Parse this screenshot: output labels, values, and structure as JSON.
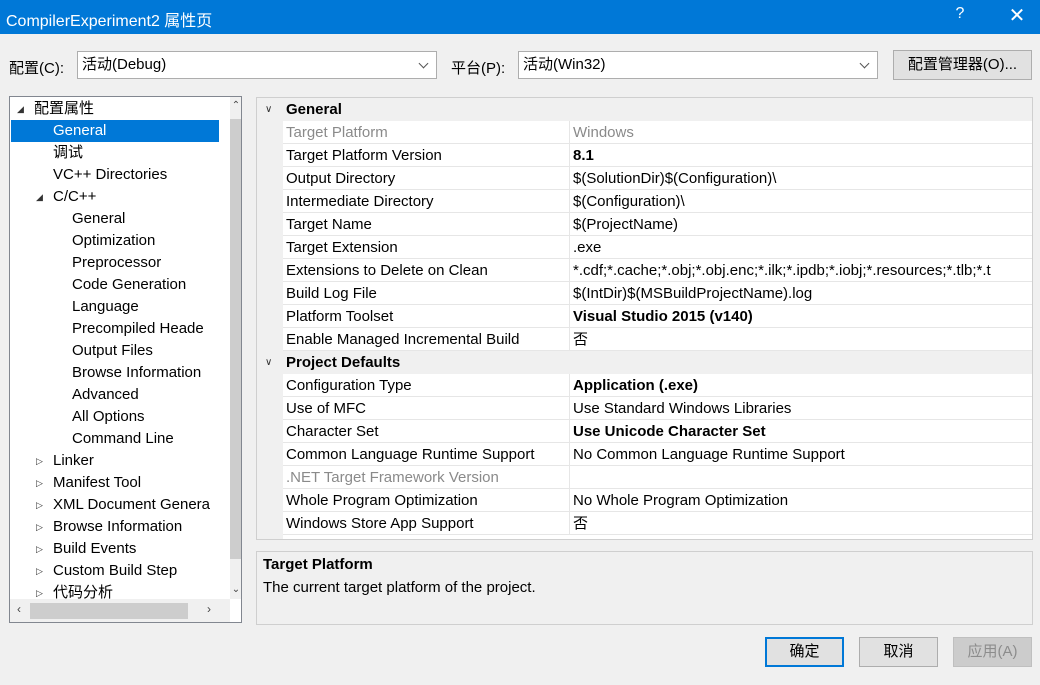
{
  "window": {
    "title": "CompilerExperiment2 属性页",
    "help_glyph": "?",
    "close_glyph": "✕"
  },
  "toolbar": {
    "config_label": "配置(C):",
    "config_value": "活动(Debug)",
    "platform_label": "平台(P):",
    "platform_value": "活动(Win32)",
    "config_manager_label": "配置管理器(O)..."
  },
  "tree": {
    "items": [
      {
        "label": "配置属性",
        "expander": "◢"
      },
      {
        "label": "General"
      },
      {
        "label": "调试"
      },
      {
        "label": "VC++ Directories"
      },
      {
        "label": "C/C++",
        "expander": "◢"
      },
      {
        "label": "General"
      },
      {
        "label": "Optimization"
      },
      {
        "label": "Preprocessor"
      },
      {
        "label": "Code Generation"
      },
      {
        "label": "Language"
      },
      {
        "label": "Precompiled Heade"
      },
      {
        "label": "Output Files"
      },
      {
        "label": "Browse Information"
      },
      {
        "label": "Advanced"
      },
      {
        "label": "All Options"
      },
      {
        "label": "Command Line"
      },
      {
        "label": "Linker",
        "expander": "▷"
      },
      {
        "label": "Manifest Tool",
        "expander": "▷"
      },
      {
        "label": "XML Document Genera",
        "expander": "▷"
      },
      {
        "label": "Browse Information",
        "expander": "▷"
      },
      {
        "label": "Build Events",
        "expander": "▷"
      },
      {
        "label": "Custom Build Step",
        "expander": "▷"
      },
      {
        "label": "代码分析",
        "expander": "▷"
      }
    ],
    "selected_index": 1
  },
  "grid": {
    "categories": [
      {
        "label": "General",
        "props": [
          {
            "name": "Target Platform",
            "value": "Windows",
            "dim": true
          },
          {
            "name": "Target Platform Version",
            "value": "8.1",
            "bold": true
          },
          {
            "name": "Output Directory",
            "value": "$(SolutionDir)$(Configuration)\\"
          },
          {
            "name": "Intermediate Directory",
            "value": "$(Configuration)\\"
          },
          {
            "name": "Target Name",
            "value": "$(ProjectName)"
          },
          {
            "name": "Target Extension",
            "value": ".exe"
          },
          {
            "name": "Extensions to Delete on Clean",
            "value": "*.cdf;*.cache;*.obj;*.obj.enc;*.ilk;*.ipdb;*.iobj;*.resources;*.tlb;*.t"
          },
          {
            "name": "Build Log File",
            "value": "$(IntDir)$(MSBuildProjectName).log"
          },
          {
            "name": "Platform Toolset",
            "value": "Visual Studio 2015 (v140)",
            "bold": true
          },
          {
            "name": "Enable Managed Incremental Build",
            "value": "否"
          }
        ]
      },
      {
        "label": "Project Defaults",
        "props": [
          {
            "name": "Configuration Type",
            "value": "Application (.exe)",
            "bold": true
          },
          {
            "name": "Use of MFC",
            "value": "Use Standard Windows Libraries"
          },
          {
            "name": "Character Set",
            "value": "Use Unicode Character Set",
            "bold": true
          },
          {
            "name": "Common Language Runtime Support",
            "value": "No Common Language Runtime Support"
          },
          {
            "name": ".NET Target Framework Version",
            "value": "",
            "dim": true
          },
          {
            "name": "Whole Program Optimization",
            "value": "No Whole Program Optimization"
          },
          {
            "name": "Windows Store App Support",
            "value": "否"
          }
        ]
      }
    ]
  },
  "description": {
    "title": "Target Platform",
    "text": "The current target platform of the project."
  },
  "buttons": {
    "ok": "确定",
    "cancel": "取消",
    "apply": "应用(A)"
  }
}
